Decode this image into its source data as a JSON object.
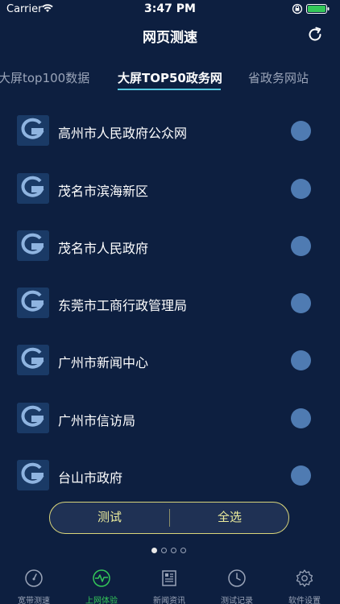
{
  "status_bar": {
    "carrier": "Carrier",
    "time": "3:47 PM"
  },
  "header": {
    "title": "网页测速",
    "refresh_icon": "refresh-icon"
  },
  "tabs": [
    {
      "label": "大屏top100数据",
      "active": false
    },
    {
      "label": "大屏TOP50政务网",
      "active": true
    },
    {
      "label": "省政务网站",
      "active": false
    }
  ],
  "list": {
    "items": [
      {
        "label": "高州市人民政府公众网",
        "selected": false
      },
      {
        "label": "茂名市滨海新区",
        "selected": false
      },
      {
        "label": "茂名市人民政府",
        "selected": false
      },
      {
        "label": "东莞市工商行政管理局",
        "selected": false
      },
      {
        "label": "广州市新闻中心",
        "selected": false
      },
      {
        "label": "广州市信访局",
        "selected": false
      },
      {
        "label": "台山市政府",
        "selected": false
      }
    ]
  },
  "actions": {
    "test_label": "测试",
    "select_all_label": "全选"
  },
  "pager": {
    "current": 1,
    "total": 4
  },
  "tabbar": {
    "items": [
      {
        "label": "宽带测速",
        "icon": "gauge-icon",
        "active": false
      },
      {
        "label": "上网体验",
        "icon": "pulse-icon",
        "active": true
      },
      {
        "label": "新闻资讯",
        "icon": "newspaper-icon",
        "active": false
      },
      {
        "label": "测试记录",
        "icon": "clock-icon",
        "active": false
      },
      {
        "label": "软件设置",
        "icon": "gear-icon",
        "active": false
      }
    ]
  },
  "colors": {
    "background": "#0d1f40",
    "accent_tab": "#56c9e0",
    "toggle": "#4f7bb2",
    "action_text": "#ecec9c",
    "tabbar_active": "#34c759"
  }
}
